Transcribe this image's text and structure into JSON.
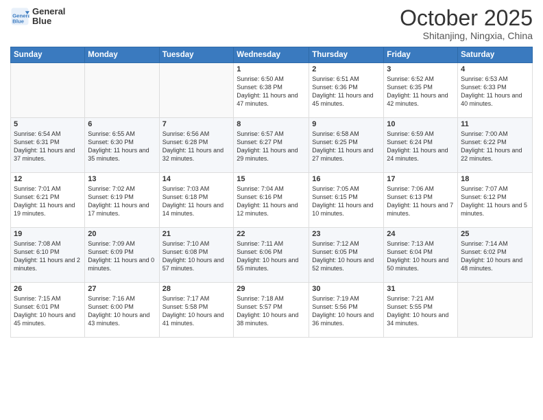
{
  "logo": {
    "line1": "General",
    "line2": "Blue"
  },
  "title": "October 2025",
  "location": "Shitanjing, Ningxia, China",
  "weekdays": [
    "Sunday",
    "Monday",
    "Tuesday",
    "Wednesday",
    "Thursday",
    "Friday",
    "Saturday"
  ],
  "weeks": [
    [
      {
        "day": "",
        "info": ""
      },
      {
        "day": "",
        "info": ""
      },
      {
        "day": "",
        "info": ""
      },
      {
        "day": "1",
        "info": "Sunrise: 6:50 AM\nSunset: 6:38 PM\nDaylight: 11 hours and 47 minutes."
      },
      {
        "day": "2",
        "info": "Sunrise: 6:51 AM\nSunset: 6:36 PM\nDaylight: 11 hours and 45 minutes."
      },
      {
        "day": "3",
        "info": "Sunrise: 6:52 AM\nSunset: 6:35 PM\nDaylight: 11 hours and 42 minutes."
      },
      {
        "day": "4",
        "info": "Sunrise: 6:53 AM\nSunset: 6:33 PM\nDaylight: 11 hours and 40 minutes."
      }
    ],
    [
      {
        "day": "5",
        "info": "Sunrise: 6:54 AM\nSunset: 6:31 PM\nDaylight: 11 hours and 37 minutes."
      },
      {
        "day": "6",
        "info": "Sunrise: 6:55 AM\nSunset: 6:30 PM\nDaylight: 11 hours and 35 minutes."
      },
      {
        "day": "7",
        "info": "Sunrise: 6:56 AM\nSunset: 6:28 PM\nDaylight: 11 hours and 32 minutes."
      },
      {
        "day": "8",
        "info": "Sunrise: 6:57 AM\nSunset: 6:27 PM\nDaylight: 11 hours and 29 minutes."
      },
      {
        "day": "9",
        "info": "Sunrise: 6:58 AM\nSunset: 6:25 PM\nDaylight: 11 hours and 27 minutes."
      },
      {
        "day": "10",
        "info": "Sunrise: 6:59 AM\nSunset: 6:24 PM\nDaylight: 11 hours and 24 minutes."
      },
      {
        "day": "11",
        "info": "Sunrise: 7:00 AM\nSunset: 6:22 PM\nDaylight: 11 hours and 22 minutes."
      }
    ],
    [
      {
        "day": "12",
        "info": "Sunrise: 7:01 AM\nSunset: 6:21 PM\nDaylight: 11 hours and 19 minutes."
      },
      {
        "day": "13",
        "info": "Sunrise: 7:02 AM\nSunset: 6:19 PM\nDaylight: 11 hours and 17 minutes."
      },
      {
        "day": "14",
        "info": "Sunrise: 7:03 AM\nSunset: 6:18 PM\nDaylight: 11 hours and 14 minutes."
      },
      {
        "day": "15",
        "info": "Sunrise: 7:04 AM\nSunset: 6:16 PM\nDaylight: 11 hours and 12 minutes."
      },
      {
        "day": "16",
        "info": "Sunrise: 7:05 AM\nSunset: 6:15 PM\nDaylight: 11 hours and 10 minutes."
      },
      {
        "day": "17",
        "info": "Sunrise: 7:06 AM\nSunset: 6:13 PM\nDaylight: 11 hours and 7 minutes."
      },
      {
        "day": "18",
        "info": "Sunrise: 7:07 AM\nSunset: 6:12 PM\nDaylight: 11 hours and 5 minutes."
      }
    ],
    [
      {
        "day": "19",
        "info": "Sunrise: 7:08 AM\nSunset: 6:10 PM\nDaylight: 11 hours and 2 minutes."
      },
      {
        "day": "20",
        "info": "Sunrise: 7:09 AM\nSunset: 6:09 PM\nDaylight: 11 hours and 0 minutes."
      },
      {
        "day": "21",
        "info": "Sunrise: 7:10 AM\nSunset: 6:08 PM\nDaylight: 10 hours and 57 minutes."
      },
      {
        "day": "22",
        "info": "Sunrise: 7:11 AM\nSunset: 6:06 PM\nDaylight: 10 hours and 55 minutes."
      },
      {
        "day": "23",
        "info": "Sunrise: 7:12 AM\nSunset: 6:05 PM\nDaylight: 10 hours and 52 minutes."
      },
      {
        "day": "24",
        "info": "Sunrise: 7:13 AM\nSunset: 6:04 PM\nDaylight: 10 hours and 50 minutes."
      },
      {
        "day": "25",
        "info": "Sunrise: 7:14 AM\nSunset: 6:02 PM\nDaylight: 10 hours and 48 minutes."
      }
    ],
    [
      {
        "day": "26",
        "info": "Sunrise: 7:15 AM\nSunset: 6:01 PM\nDaylight: 10 hours and 45 minutes."
      },
      {
        "day": "27",
        "info": "Sunrise: 7:16 AM\nSunset: 6:00 PM\nDaylight: 10 hours and 43 minutes."
      },
      {
        "day": "28",
        "info": "Sunrise: 7:17 AM\nSunset: 5:58 PM\nDaylight: 10 hours and 41 minutes."
      },
      {
        "day": "29",
        "info": "Sunrise: 7:18 AM\nSunset: 5:57 PM\nDaylight: 10 hours and 38 minutes."
      },
      {
        "day": "30",
        "info": "Sunrise: 7:19 AM\nSunset: 5:56 PM\nDaylight: 10 hours and 36 minutes."
      },
      {
        "day": "31",
        "info": "Sunrise: 7:21 AM\nSunset: 5:55 PM\nDaylight: 10 hours and 34 minutes."
      },
      {
        "day": "",
        "info": ""
      }
    ]
  ]
}
